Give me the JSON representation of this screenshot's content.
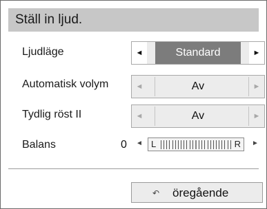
{
  "menu": {
    "title": "Ställ in ljud.",
    "rows": [
      {
        "label": "Ljudläge",
        "value": "Standard",
        "state": "active"
      },
      {
        "label": "Automatisk volym",
        "value": "Av",
        "state": "dim"
      },
      {
        "label": "Tydlig röst II",
        "value": "Av",
        "state": "dim"
      }
    ],
    "balance": {
      "label": "Balans",
      "value": "0",
      "left": "L",
      "right": "R"
    },
    "back": {
      "label": "öregående",
      "icon": "back-arrow-icon"
    },
    "arrows": {
      "left": "◄",
      "right": "►"
    }
  }
}
